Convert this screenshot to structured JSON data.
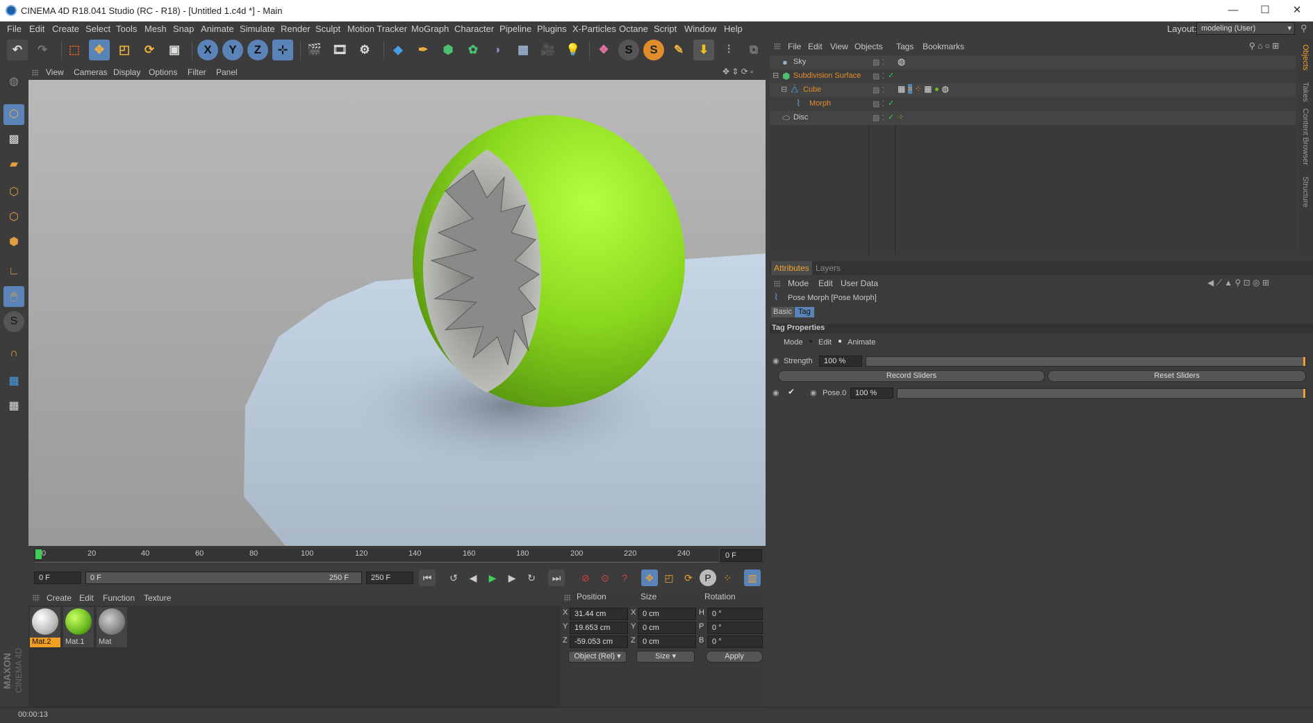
{
  "window": {
    "title": "CINEMA 4D R18.041 Studio (RC - R18) - [Untitled 1.c4d *] - Main",
    "minimize": "—",
    "maximize": "☐",
    "close": "✕"
  },
  "menu": [
    "File",
    "Edit",
    "Create",
    "Select",
    "Tools",
    "Mesh",
    "Snap",
    "Animate",
    "Simulate",
    "Render",
    "Sculpt",
    "Motion Tracker",
    "MoGraph",
    "Character",
    "Pipeline",
    "Plugins",
    "X-Particles",
    "Octane",
    "Script",
    "Window",
    "Help"
  ],
  "layout": {
    "label": "Layout:",
    "value": "modeling (User)"
  },
  "axis_buttons": [
    "X",
    "Y",
    "Z"
  ],
  "viewport": {
    "menu": [
      "View",
      "Cameras",
      "Display",
      "Options",
      "Filter",
      "Panel"
    ]
  },
  "timeline": {
    "ticks": [
      "0",
      "20",
      "40",
      "60",
      "80",
      "100",
      "120",
      "140",
      "160",
      "180",
      "200",
      "220",
      "240"
    ],
    "current": "0 F"
  },
  "transport": {
    "start": "0 F",
    "range_start": "0 F",
    "range_end": "250 F",
    "end": "250 F"
  },
  "material_manager": {
    "menu": [
      "Create",
      "Edit",
      "Function",
      "Texture"
    ],
    "materials": [
      {
        "name": "Mat.2",
        "selected": true
      },
      {
        "name": "Mat.1",
        "selected": false
      },
      {
        "name": "Mat",
        "selected": false
      }
    ]
  },
  "coordinates": {
    "headers": [
      "Position",
      "Size",
      "Rotation"
    ],
    "rows": [
      {
        "axis": "X",
        "pos": "31.44 cm",
        "size_axis": "X",
        "size": "0 cm",
        "rot_axis": "H",
        "rot": "0 °"
      },
      {
        "axis": "Y",
        "pos": "19.653 cm",
        "size_axis": "Y",
        "size": "0 cm",
        "rot_axis": "P",
        "rot": "0 °"
      },
      {
        "axis": "Z",
        "pos": "-59.053 cm",
        "size_axis": "Z",
        "size": "0 cm",
        "rot_axis": "B",
        "rot": "0 °"
      }
    ],
    "mode": "Object (Rel)",
    "size_mode": "Size",
    "apply": "Apply"
  },
  "status": {
    "time": "00:00:13"
  },
  "object_manager": {
    "menu": [
      "File",
      "Edit",
      "View",
      "Objects",
      "Tags",
      "Bookmarks"
    ],
    "objects": [
      {
        "name": "Sky",
        "indent": 0,
        "color": "#c8c8c8"
      },
      {
        "name": "Subdivision Surface",
        "indent": 0,
        "color": "#e28d2c"
      },
      {
        "name": "Cube",
        "indent": 1,
        "color": "#e28d2c"
      },
      {
        "name": "Morph",
        "indent": 2,
        "color": "#e28d2c"
      },
      {
        "name": "Disc",
        "indent": 0,
        "color": "#c8c8c8"
      }
    ]
  },
  "side_tabs": [
    "Objects",
    "Takes",
    "Content Browser",
    "Structure"
  ],
  "attributes": {
    "tabs": [
      "Attributes",
      "Layers"
    ],
    "menu": [
      "Mode",
      "Edit",
      "User Data"
    ],
    "object_title": "Pose Morph [Pose Morph]",
    "subtabs": [
      "Basic",
      "Tag"
    ],
    "section": "Tag Properties",
    "mode_label": "Mode",
    "mode_edit": "Edit",
    "mode_animate": "Animate",
    "strength_label": "Strength",
    "strength_value": "100 %",
    "record": "Record Sliders",
    "reset": "Reset Sliders",
    "pose_label": "Pose.0",
    "pose_value": "100 %"
  },
  "maxon": {
    "brand": "MAXON",
    "product": "CINEMA 4D"
  }
}
